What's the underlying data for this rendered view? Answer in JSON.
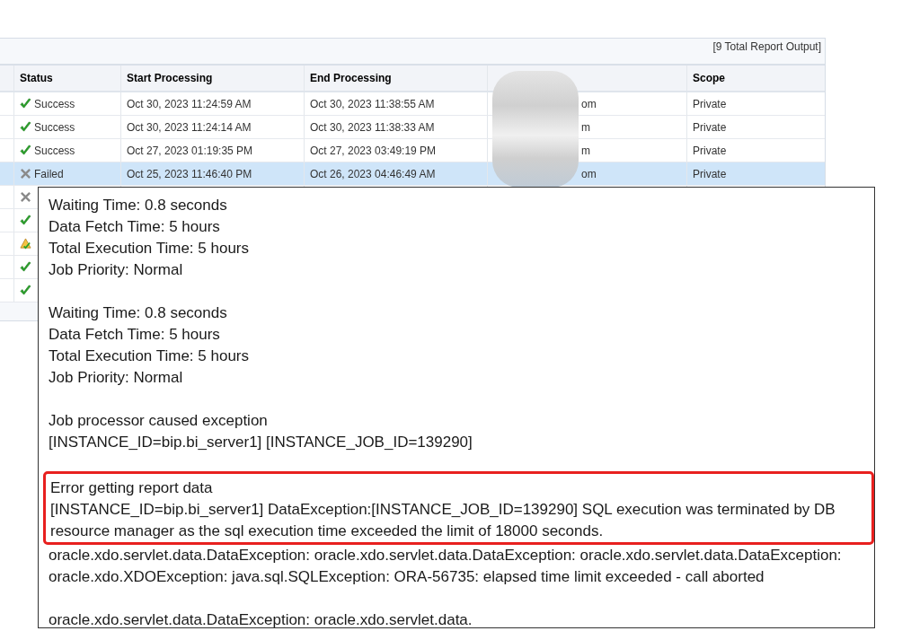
{
  "table": {
    "total": "[9 Total Report Output]",
    "columns": [
      "Status",
      "Start Processing",
      "End Processing",
      "Scope"
    ],
    "rows": [
      {
        "kind": "success",
        "status": "Success",
        "start": "Oct 30, 2023 11:24:59 AM",
        "end": "Oct 30, 2023 11:38:55 AM",
        "owner": "om",
        "scope": "Private",
        "selected": false
      },
      {
        "kind": "success",
        "status": "Success",
        "start": "Oct 30, 2023 11:24:14 AM",
        "end": "Oct 30, 2023 11:38:33 AM",
        "owner": "m",
        "scope": "Private",
        "selected": false
      },
      {
        "kind": "success",
        "status": "Success",
        "start": "Oct 27, 2023 01:19:35 PM",
        "end": "Oct 27, 2023 03:49:19 PM",
        "owner": "m",
        "scope": "Private",
        "selected": false
      },
      {
        "kind": "failed",
        "status": "Failed",
        "start": "Oct 25, 2023 11:46:40 PM",
        "end": "Oct 26, 2023 04:46:49 AM",
        "owner": "om",
        "scope": "Private",
        "selected": true
      },
      {
        "kind": "failed",
        "selected": false
      },
      {
        "kind": "success",
        "selected": false
      },
      {
        "kind": "warning",
        "selected": false
      },
      {
        "kind": "success",
        "selected": false
      },
      {
        "kind": "success",
        "selected": false
      }
    ]
  },
  "tooltip": {
    "blocks": [
      {
        "highlighted": false,
        "lines": [
          "Waiting Time: 0.8 seconds",
          "Data Fetch Time: 5 hours",
          "Total Execution Time: 5 hours",
          "Job Priority: Normal"
        ]
      },
      {
        "highlighted": false,
        "lines": [
          "Waiting Time: 0.8 seconds",
          "Data Fetch Time: 5 hours",
          "Total Execution Time: 5 hours",
          "Job Priority: Normal"
        ]
      },
      {
        "highlighted": false,
        "lines": [
          "Job processor caused exception",
          "[INSTANCE_ID=bip.bi_server1] [INSTANCE_JOB_ID=139290]"
        ]
      },
      {
        "highlighted": true,
        "lines": [
          "Error getting report data",
          "[INSTANCE_ID=bip.bi_server1] DataException:[INSTANCE_JOB_ID=139290] SQL execution was terminated by DB resource manager as the sql execution time exceeded the limit of 18000 seconds."
        ]
      },
      {
        "highlighted": false,
        "lines": [
          "oracle.xdo.servlet.data.DataException: oracle.xdo.servlet.data.DataException: oracle.xdo.servlet.data.DataException: oracle.xdo.XDOException: java.sql.SQLException: ORA-56735: elapsed time limit exceeded - call aborted"
        ]
      },
      {
        "highlighted": false,
        "lines": [
          "oracle.xdo.servlet.data.DataException: oracle.xdo.servlet.data."
        ]
      }
    ]
  }
}
